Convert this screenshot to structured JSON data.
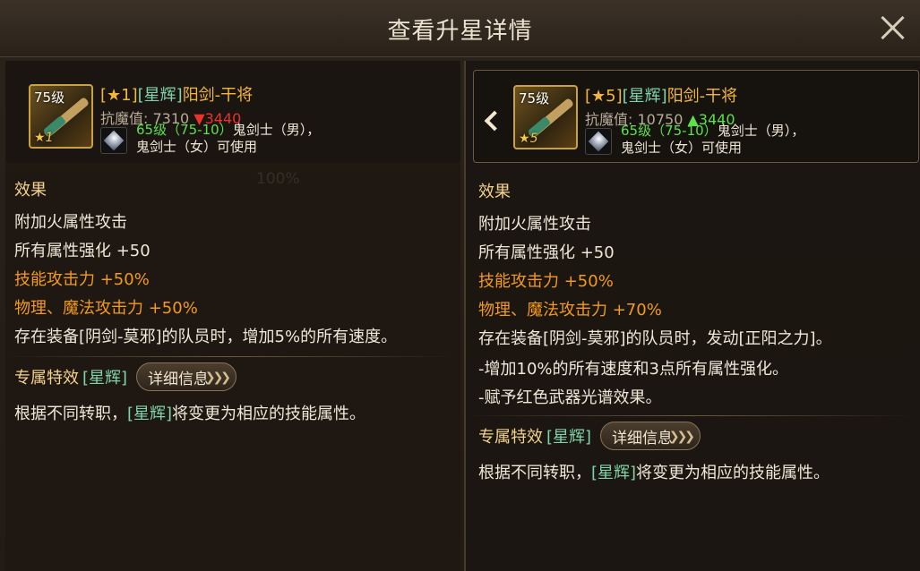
{
  "window": {
    "title": "查看升星详情"
  },
  "left": {
    "item": {
      "level_badge": "75级",
      "star_count": "1",
      "name_grade": "[★1]",
      "name_tag": "[星辉]",
      "name_text": "阳剑-干将",
      "stat_label": "抗魔值:",
      "stat_value": "7310",
      "stat_change": "▼3440",
      "req_level": "65级（75-10）",
      "req_class_1": "鬼剑士（男），",
      "req_class_2": "鬼剑士（女）可使用"
    },
    "effects_title": "效果",
    "effects": [
      {
        "text": "附加火属性攻击"
      },
      {
        "text": "所有属性强化 +50"
      },
      {
        "text": "技能攻击力 +50%"
      },
      {
        "text": "物理、魔法攻击力 +50%"
      },
      {
        "text": "存在装备[阴剑-莫邪]的队员时，增加5%的所有速度。"
      }
    ],
    "exclusive": {
      "label": "专属特效",
      "tag": "[星辉]",
      "button": "详细信息"
    },
    "desc_prefix": "根据不同转职，",
    "desc_tag": "[星辉]",
    "desc_suffix": "将变更为相应的技能属性。"
  },
  "right": {
    "item": {
      "level_badge": "75级",
      "star_count": "5",
      "name_grade": "[★5]",
      "name_tag": "[星辉]",
      "name_text": "阳剑-干将",
      "stat_label": "抗魔值:",
      "stat_value": "10750",
      "stat_change": "▲3440",
      "req_level": "65级（75-10）",
      "req_class_1": "鬼剑士（男），",
      "req_class_2": "鬼剑士（女）可使用"
    },
    "effects_title": "效果",
    "effects": [
      {
        "text": "附加火属性攻击"
      },
      {
        "text": "所有属性强化 +50"
      },
      {
        "text": "技能攻击力 +50%"
      },
      {
        "text": "物理、魔法攻击力 +70%"
      },
      {
        "text": "存在装备[阴剑-莫邪]的队员时，发动[正阳之力]。"
      },
      {
        "text": "-增加10%的所有速度和3点所有属性强化。"
      },
      {
        "text": "-赋予红色武器光谱效果。"
      }
    ],
    "exclusive": {
      "label": "专属特效",
      "tag": "[星辉]",
      "button": "详细信息"
    },
    "desc_prefix": "根据不同转职，",
    "desc_tag": "[星辉]",
    "desc_suffix": "将变更为相应的技能属性。"
  }
}
